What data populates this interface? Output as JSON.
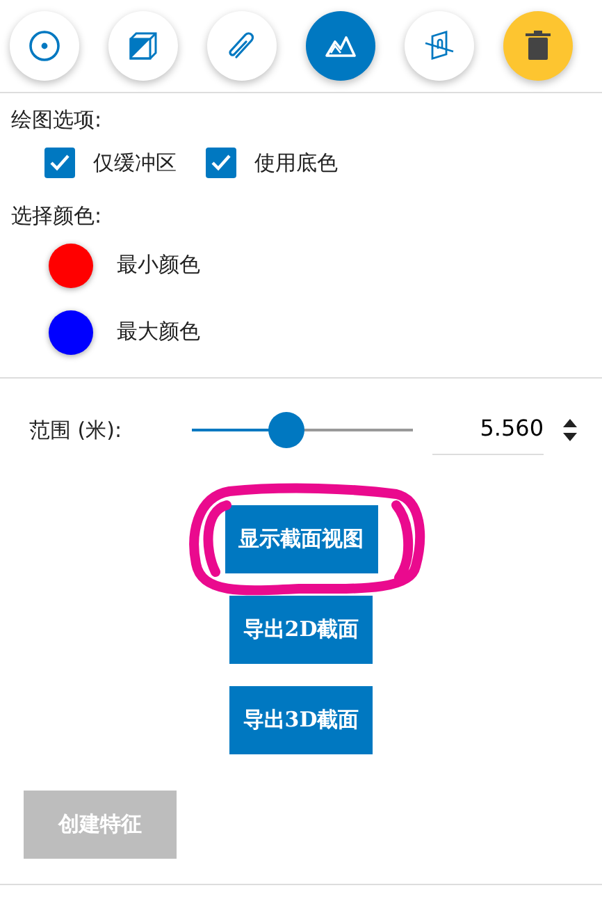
{
  "toolbar": [
    {
      "kind": "point",
      "selected": false
    },
    {
      "kind": "box",
      "selected": false
    },
    {
      "kind": "clip",
      "selected": false
    },
    {
      "kind": "terrain",
      "selected": true
    },
    {
      "kind": "plane",
      "selected": false
    },
    {
      "kind": "delete",
      "selected": false
    }
  ],
  "draw_options": {
    "label": "绘图选项:",
    "checkboxes": [
      {
        "label": "仅缓冲区",
        "checked": true
      },
      {
        "label": "使用底色",
        "checked": true
      }
    ]
  },
  "colors": {
    "label": "选择颜色:",
    "items": [
      {
        "label": "最小颜色",
        "color": "#ff0000"
      },
      {
        "label": "最大颜色",
        "color": "#0000ff"
      }
    ]
  },
  "range": {
    "label": "范围 (米):",
    "level": 0.43,
    "value": "5.560"
  },
  "buttons": [
    {
      "label": "显示截面视图",
      "highlighted": true
    },
    {
      "label": "导出2D截面",
      "highlighted": false
    },
    {
      "label": "导出3D截面",
      "highlighted": false
    }
  ],
  "create_button": {
    "label": "创建特征",
    "disabled": true
  }
}
